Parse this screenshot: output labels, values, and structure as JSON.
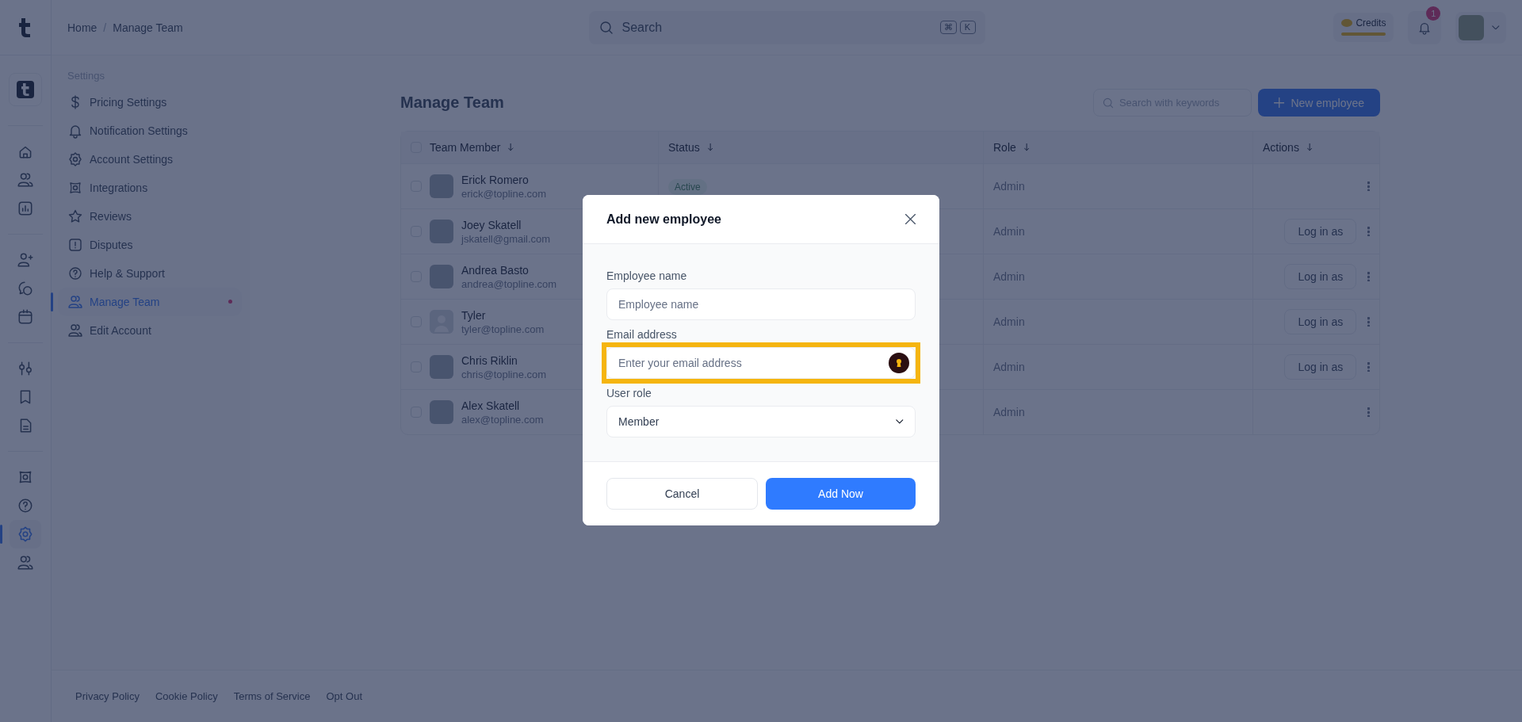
{
  "rail": [
    {
      "selected": false
    },
    {
      "selected": false
    },
    {
      "selected": false
    },
    {
      "selected": false
    },
    {
      "selected": false
    },
    {
      "selected": false
    },
    {
      "selected": false
    },
    {
      "selected": false
    },
    {
      "selected": false
    },
    {
      "selected": false
    },
    {
      "selected": false
    },
    {
      "selected": true
    },
    {
      "selected": false
    }
  ],
  "breadcrumb": {
    "items": [
      "Home",
      "Manage Team"
    ],
    "separator": "/"
  },
  "top_search": {
    "placeholder": "Search",
    "keys": [
      "⌘",
      "K"
    ]
  },
  "credits": {
    "label": "Credits"
  },
  "notifications": {
    "badge": "1"
  },
  "settings_menu": {
    "heading": "Settings",
    "items": [
      {
        "label": "Pricing Settings",
        "selected": false,
        "unread": false
      },
      {
        "label": "Notification Settings",
        "selected": false,
        "unread": false
      },
      {
        "label": "Account Settings",
        "selected": false,
        "unread": false
      },
      {
        "label": "Integrations",
        "selected": false,
        "unread": false
      },
      {
        "label": "Reviews",
        "selected": false,
        "unread": false
      },
      {
        "label": "Disputes",
        "selected": false,
        "unread": false
      },
      {
        "label": "Help & Support",
        "selected": false,
        "unread": false
      },
      {
        "label": "Manage Team",
        "selected": true,
        "unread": true
      },
      {
        "label": "Edit Account",
        "selected": false,
        "unread": false
      }
    ]
  },
  "page": {
    "title": "Manage Team",
    "search_placeholder": "Search with keywords",
    "new_button": "New employee"
  },
  "table": {
    "all_checked": false,
    "columns": [
      "Team Member",
      "Status",
      "Role",
      "Actions"
    ],
    "rows": [
      {
        "name": "Erick Romero",
        "email": "erick@topline.com",
        "kind": "photo",
        "checked": false,
        "status": "Active",
        "role": "Admin"
      },
      {
        "name": "Joey Skatell",
        "email": "jskatell@gmail.com",
        "kind": "photo",
        "checked": false,
        "role": "Admin",
        "login_button": "Log in as"
      },
      {
        "name": "Andrea Basto",
        "email": "andrea@topline.com",
        "kind": "photo",
        "checked": false,
        "role": "Admin",
        "login_button": "Log in as"
      },
      {
        "name": "Tyler",
        "email": "tyler@topline.com",
        "kind": "placeholder",
        "checked": false,
        "role": "Admin",
        "login_button": "Log in as"
      },
      {
        "name": "Chris Riklin",
        "email": "chris@topline.com",
        "kind": "photo",
        "checked": false,
        "role": "Admin",
        "login_button": "Log in as"
      },
      {
        "name": "Alex Skatell",
        "email": "alex@topline.com",
        "kind": "photo",
        "checked": false,
        "role": "Admin"
      }
    ]
  },
  "modal": {
    "title": "Add new employee",
    "fields": [
      {
        "label": "Employee name",
        "placeholder": "Employee name",
        "highlighted": false,
        "kind": "text"
      },
      {
        "label": "Email address",
        "placeholder": "Enter your email address",
        "highlighted": true,
        "kind": "email"
      },
      {
        "label": "User role",
        "value": "Member",
        "highlighted": false,
        "kind": "select"
      }
    ],
    "cancel": "Cancel",
    "submit": "Add Now"
  },
  "footer": [
    "Privacy Policy",
    "Cookie Policy",
    "Terms of Service",
    "Opt Out"
  ]
}
